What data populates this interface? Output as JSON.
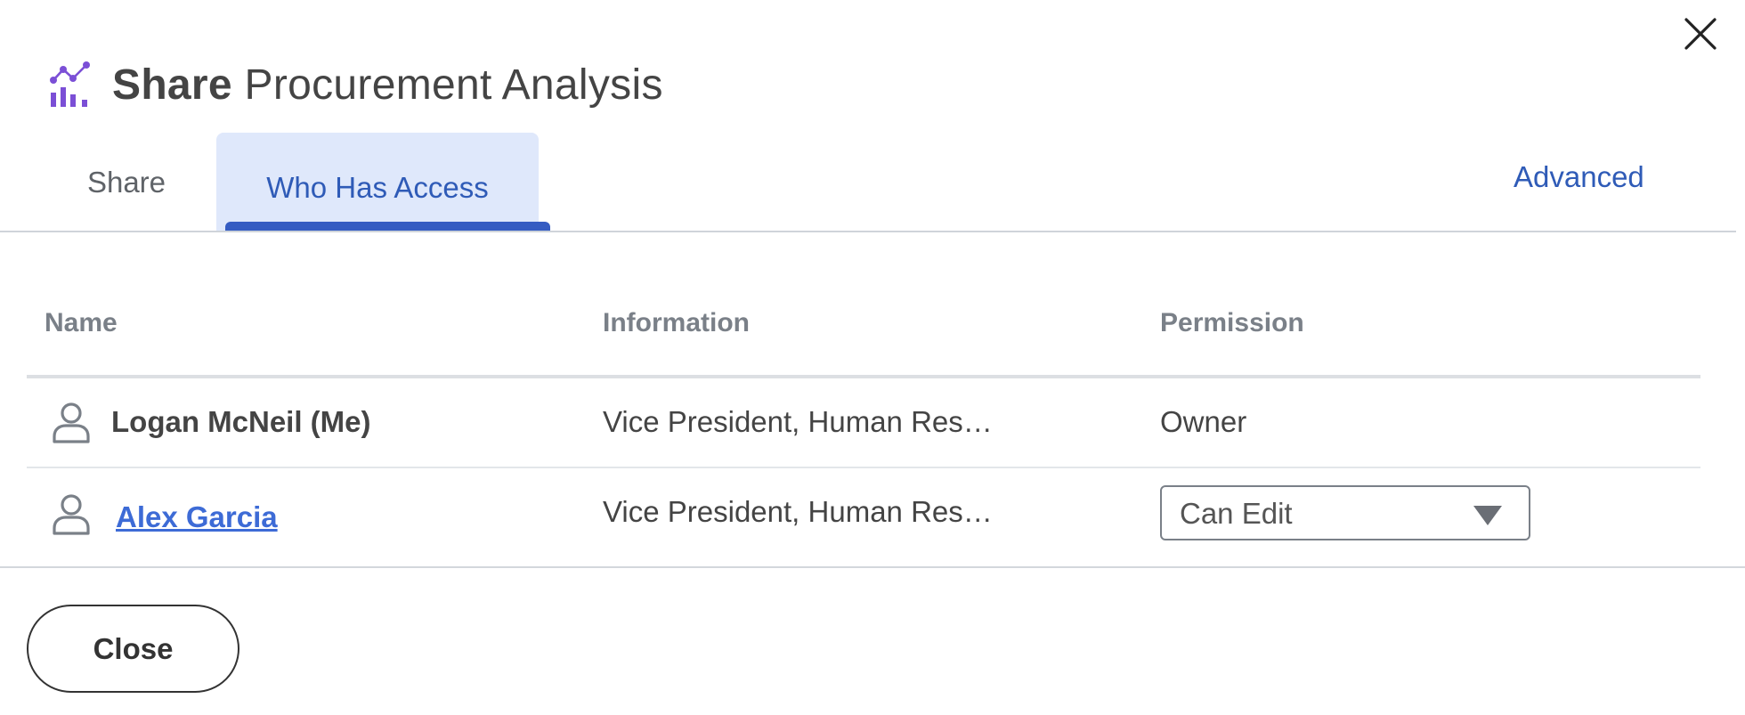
{
  "dialog": {
    "title_bold": "Share",
    "title_rest": " Procurement Analysis",
    "title_icon": "chart-analysis-icon",
    "close_icon": "close-icon"
  },
  "tabs": [
    {
      "label": "Share",
      "active": false
    },
    {
      "label": "Who Has Access",
      "active": true
    }
  ],
  "advanced_link": "Advanced",
  "table": {
    "columns": [
      "Name",
      "Information",
      "Permission"
    ],
    "rows": [
      {
        "name": "Logan McNeil (Me)",
        "information": "Vice President, Human Res…",
        "permission": "Owner",
        "icon": "person-icon"
      },
      {
        "name": "Alex Garcia",
        "information": "Vice President, Human Res…",
        "permission": "Can Edit",
        "icon": "person-icon"
      }
    ]
  },
  "footer": {
    "close_label": "Close"
  },
  "colors": {
    "accent": "#2f5bb7",
    "active_tab_bg": "#dfe8fb",
    "link": "#3d6bd6",
    "icon_purple": "#7b4fd6"
  }
}
